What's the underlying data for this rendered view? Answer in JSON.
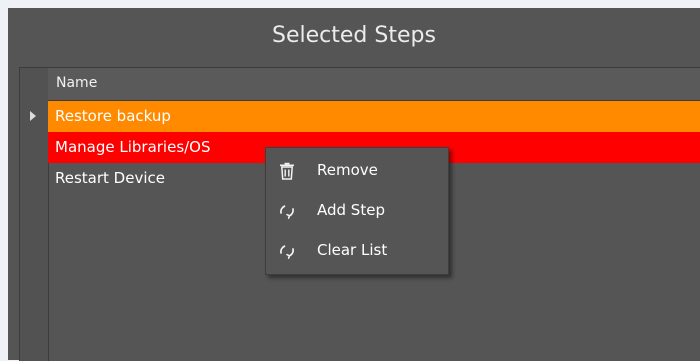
{
  "panel": {
    "title": "Selected Steps"
  },
  "table": {
    "column_header": "Name",
    "rows": [
      {
        "label": "Restore backup",
        "color": "#ff8a00",
        "current": true
      },
      {
        "label": "Manage Libraries/OS",
        "color": "#ff0000",
        "current": false
      },
      {
        "label": "Restart Device",
        "color": "",
        "current": false
      }
    ]
  },
  "context_menu": {
    "items": [
      {
        "label": "Remove",
        "icon": "trash-icon"
      },
      {
        "label": "Add Step",
        "icon": "refresh-icon"
      },
      {
        "label": "Clear List",
        "icon": "refresh-icon"
      }
    ]
  },
  "colors": {
    "background": "#555555",
    "current_row": "#ff8a00",
    "error_row": "#ff0000",
    "text": "#ffffff"
  }
}
